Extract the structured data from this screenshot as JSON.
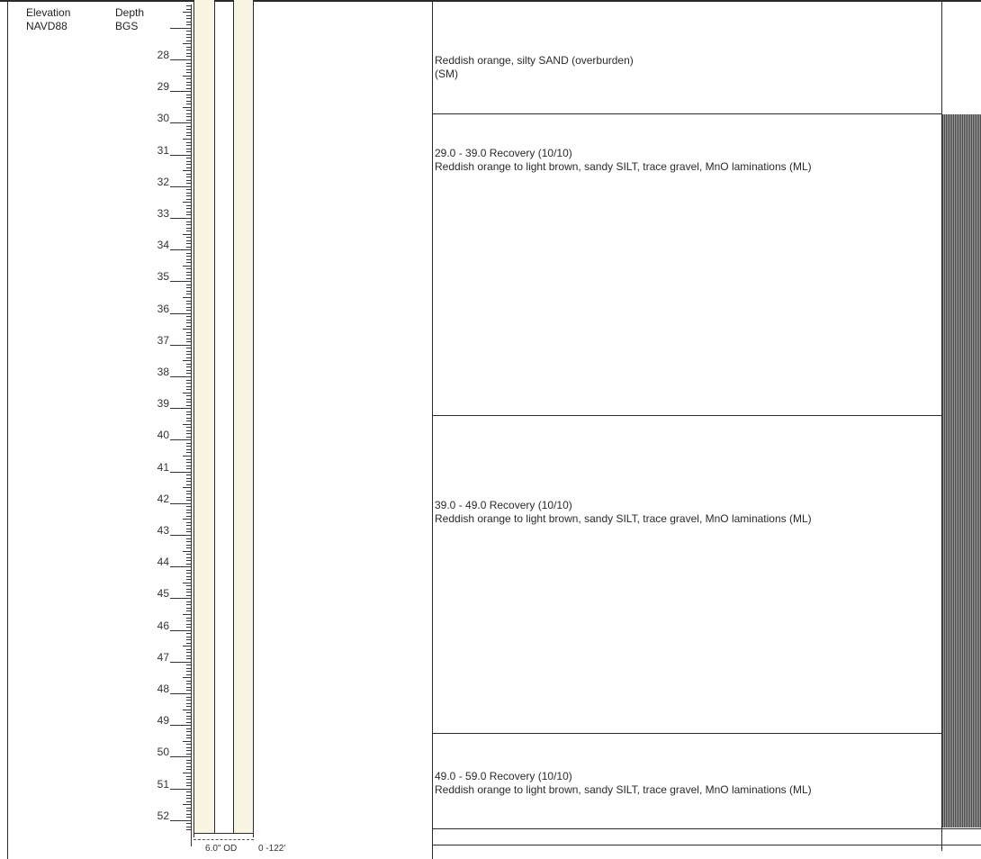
{
  "header": {
    "elevation_label": "Elevation",
    "elevation_unit": "NAVD88",
    "depth_label": "Depth",
    "depth_unit": "BGS"
  },
  "depth_labels": [
    "28",
    "29",
    "30",
    "31",
    "32",
    "33",
    "34",
    "35",
    "36",
    "37",
    "38",
    "39",
    "40",
    "41",
    "42",
    "43",
    "44",
    "45",
    "46",
    "47",
    "48",
    "49",
    "50",
    "51",
    "52"
  ],
  "descriptions": [
    {
      "line1": "Reddish orange, silty SAND (overburden)",
      "line2": "(SM)"
    },
    {
      "line1": "29.0 - 39.0 Recovery (10/10)",
      "line2": "Reddish orange to light brown, sandy SILT, trace gravel, MnO laminations (ML)"
    },
    {
      "line1": "39.0 - 49.0 Recovery (10/10)",
      "line2": "Reddish orange to light brown, sandy SILT, trace gravel, MnO laminations (ML)"
    },
    {
      "line1": "49.0 - 59.0 Recovery (10/10)",
      "line2": "Reddish orange to light brown, sandy SILT, trace gravel, MnO laminations (ML)"
    }
  ],
  "well": {
    "casing_label": "6.0\" OD",
    "interval_label": "0 -122'"
  },
  "colors": {
    "pipe_fill": "#f8f5e2",
    "line": "#2a2a2a",
    "hatch": "#4a4a4a"
  }
}
